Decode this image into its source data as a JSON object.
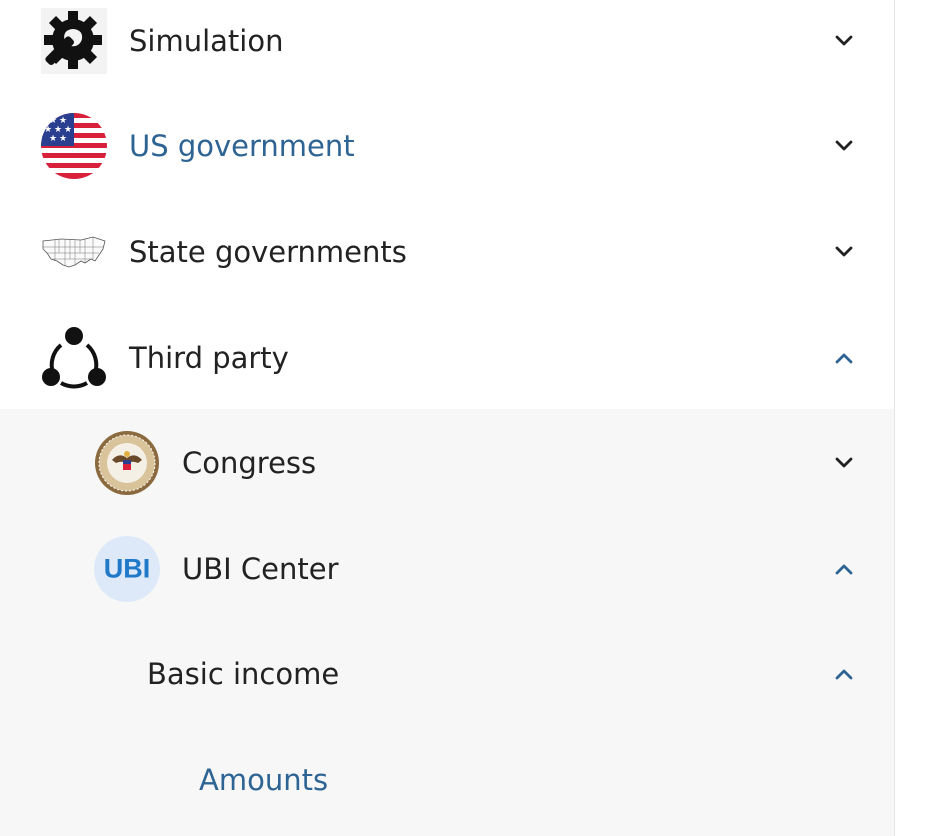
{
  "nav": {
    "items": [
      {
        "label": "Simulation",
        "icon": "gear-wrench-icon",
        "expanded": false
      },
      {
        "label": "US government",
        "icon": "us-flag-icon",
        "expanded": false,
        "active": true
      },
      {
        "label": "State governments",
        "icon": "us-states-map-icon",
        "expanded": false
      },
      {
        "label": "Third party",
        "icon": "share-nodes-icon",
        "expanded": true,
        "children": [
          {
            "label": "Congress",
            "icon": "congress-seal-icon",
            "expanded": false
          },
          {
            "label": "UBI Center",
            "icon": "ubi-logo-icon",
            "icon_text": "UBI",
            "expanded": true,
            "children": [
              {
                "label": "Basic income",
                "expanded": true,
                "children": [
                  {
                    "label": "Amounts",
                    "active": true
                  }
                ]
              }
            ]
          }
        ]
      }
    ]
  },
  "colors": {
    "active_text": "#2e6493",
    "default_text": "#222222",
    "nested_background": "#f7f7f7",
    "ubi_logo_bg": "#dde9f8",
    "ubi_logo_text": "#1f78c8"
  }
}
